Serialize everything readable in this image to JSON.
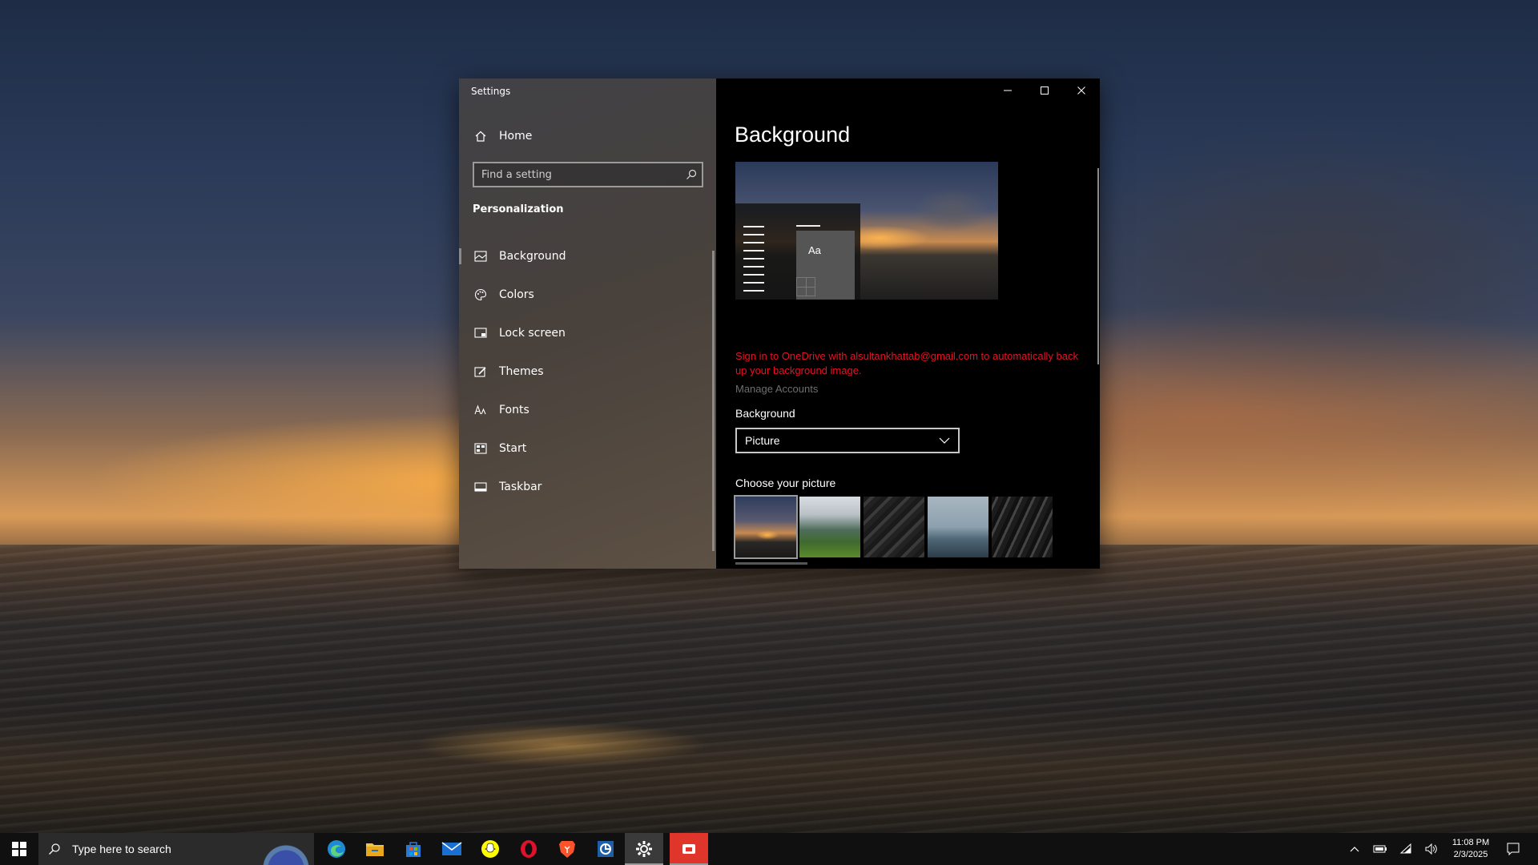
{
  "window": {
    "title": "Settings",
    "minimize_label": "—",
    "maximize_label": "☐",
    "close_label": "✕"
  },
  "sidebar": {
    "home_label": "Home",
    "search_placeholder": "Find a setting",
    "section_title": "Personalization",
    "items": [
      {
        "label": "Background",
        "icon": "picture-icon"
      },
      {
        "label": "Colors",
        "icon": "palette-icon"
      },
      {
        "label": "Lock screen",
        "icon": "lock-screen-icon"
      },
      {
        "label": "Themes",
        "icon": "brush-icon"
      },
      {
        "label": "Fonts",
        "icon": "font-icon"
      },
      {
        "label": "Start",
        "icon": "start-icon"
      },
      {
        "label": "Taskbar",
        "icon": "taskbar-icon"
      }
    ]
  },
  "main": {
    "title": "Background",
    "preview_sample_text": "Aa",
    "onedrive_message": "Sign in to OneDrive with alsultankhattab@gmail.com to automatically back up your background image.",
    "manage_accounts": "Manage Accounts",
    "background_label": "Background",
    "background_value": "Picture",
    "choose_label": "Choose your picture"
  },
  "taskbar": {
    "search_placeholder": "Type here to search",
    "apps": [
      "edge-icon",
      "file-explorer-icon",
      "store-icon",
      "mail-icon",
      "snapchat-icon",
      "opera-icon",
      "brave-icon",
      "app-icon",
      "settings-icon",
      "anydesk-icon"
    ],
    "time": "11:08 PM",
    "date": "2/3/2025"
  },
  "colors": {
    "accent_error": "#e81123",
    "window_bg": "#000000",
    "taskbar_bg": "#101010"
  }
}
